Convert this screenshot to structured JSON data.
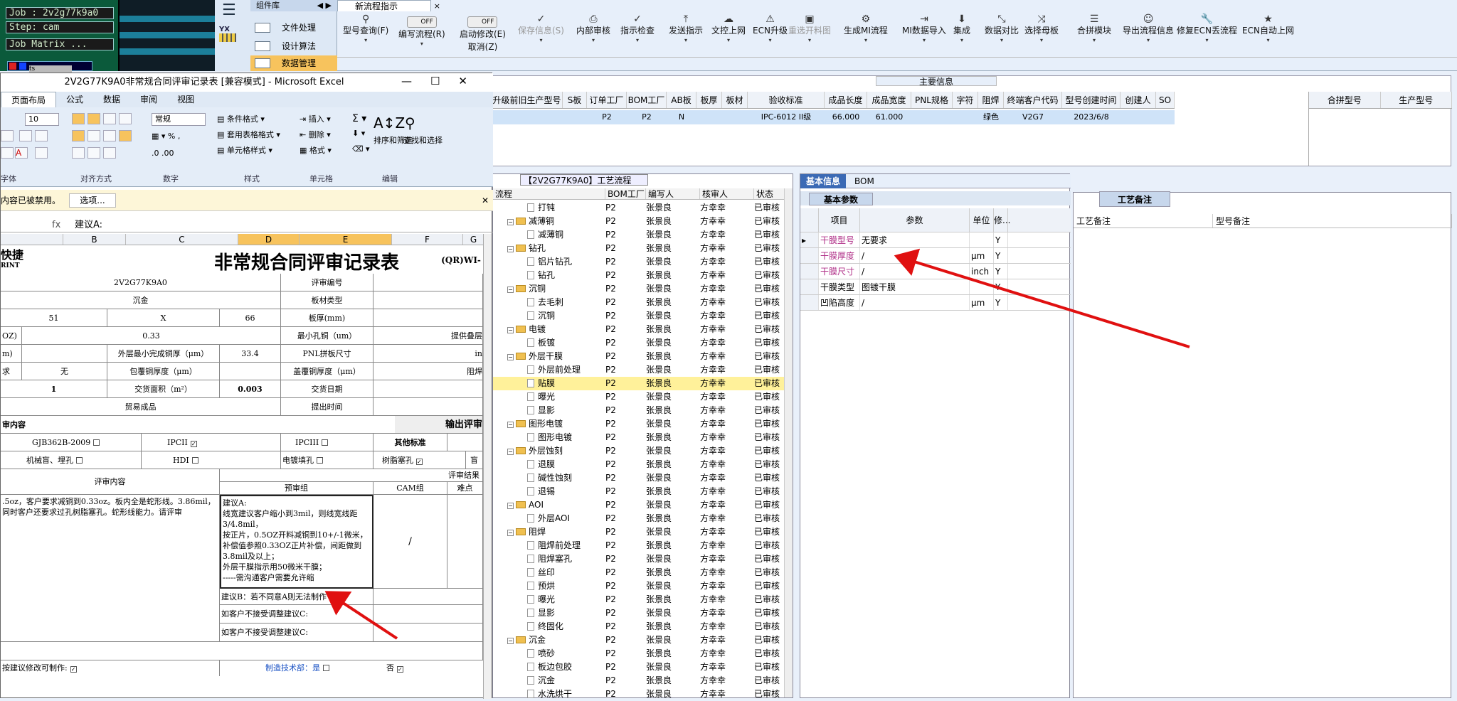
{
  "terminal": {
    "job": "Job : 2v2g77k9a0",
    "step": "Step: cam",
    "matrix": "Job Matrix ...",
    "ts": "ts"
  },
  "leftnav": {
    "logo": "YX",
    "header": "组件库",
    "items": [
      "文件处理",
      "设计算法",
      "数据管理"
    ]
  },
  "ribbon": {
    "tab": "新流程指示",
    "buttons": [
      {
        "icon": "search-icon",
        "label": "型号查询(F)"
      },
      {
        "icon": "toggle",
        "label": "编写流程(R)",
        "toggle": "OFF"
      },
      {
        "icon": "toggle",
        "label": "启动修改(E)",
        "toggle": "OFF",
        "sub": "取消(Z)"
      },
      {
        "icon": "check-icon",
        "label": "保存信息(S)",
        "disabled": true
      },
      {
        "icon": "print-icon",
        "label": "内部审核"
      },
      {
        "icon": "check-icon",
        "label": "指示检查"
      },
      {
        "icon": "upload-icon",
        "label": "发送指示"
      },
      {
        "icon": "cloud-upload-icon",
        "label": "文控上网"
      },
      {
        "icon": "ecn-icon",
        "label": "ECN升级"
      },
      {
        "icon": "image-icon",
        "label": "重选开料图",
        "disabled": true
      },
      {
        "icon": "flow-icon",
        "label": "生成MI流程"
      },
      {
        "icon": "import-icon",
        "label": "MI数据导入"
      },
      {
        "icon": "merge-icon",
        "label": "集成"
      },
      {
        "icon": "compare-icon",
        "label": "数据对比"
      },
      {
        "icon": "shuffle-icon",
        "label": "选择母板"
      },
      {
        "icon": "list-icon",
        "label": "合拼模块"
      },
      {
        "icon": "smile-icon",
        "label": "导出流程信息"
      },
      {
        "icon": "wrench-icon",
        "label": "修复ECN丢流程"
      },
      {
        "icon": "star-icon",
        "label": "ECN自动上网"
      }
    ]
  },
  "main_info": {
    "title": "主要信息",
    "columns": [
      "升级前旧生产型号",
      "S板",
      "订单工厂",
      "BOM工厂",
      "AB板",
      "板厚",
      "板材",
      "验收标准",
      "成品长度",
      "成品宽度",
      "PNL规格",
      "字符",
      "阻焊",
      "终端客户代码",
      "型号创建时间",
      "创建人",
      "SO"
    ],
    "row": [
      "",
      "",
      "P2",
      "P2",
      "N",
      "",
      "",
      "IPC-6012 II级",
      "66.000",
      "61.000",
      "",
      "",
      "绿色",
      "V2G7",
      "2023/6/8",
      "",
      ""
    ],
    "right_columns": [
      "合拼型号",
      "生产型号"
    ]
  },
  "process": {
    "title": "【2V2G77K9A0】工艺流程",
    "columns": [
      "流程",
      "BOM工厂",
      "编写人",
      "核审人",
      "状态"
    ],
    "rows": [
      {
        "name": "打钝",
        "type": "doc",
        "bom": "P2",
        "writer": "张景良",
        "reviewer": "方幸幸",
        "status": "已审核"
      },
      {
        "name": "减薄铜",
        "type": "folder",
        "bom": "P2",
        "writer": "张景良",
        "reviewer": "方幸幸",
        "status": "已审核"
      },
      {
        "name": "减薄铜",
        "type": "doc",
        "bom": "P2",
        "writer": "张景良",
        "reviewer": "方幸幸",
        "status": "已审核"
      },
      {
        "name": "钻孔",
        "type": "folder",
        "bom": "P2",
        "writer": "张景良",
        "reviewer": "方幸幸",
        "status": "已审核"
      },
      {
        "name": "铝片钻孔",
        "type": "doc",
        "bom": "P2",
        "writer": "张景良",
        "reviewer": "方幸幸",
        "status": "已审核"
      },
      {
        "name": "钻孔",
        "type": "doc",
        "bom": "P2",
        "writer": "张景良",
        "reviewer": "方幸幸",
        "status": "已审核"
      },
      {
        "name": "沉铜",
        "type": "folder",
        "bom": "P2",
        "writer": "张景良",
        "reviewer": "方幸幸",
        "status": "已审核"
      },
      {
        "name": "去毛刺",
        "type": "doc",
        "bom": "P2",
        "writer": "张景良",
        "reviewer": "方幸幸",
        "status": "已审核"
      },
      {
        "name": "沉铜",
        "type": "doc",
        "bom": "P2",
        "writer": "张景良",
        "reviewer": "方幸幸",
        "status": "已审核"
      },
      {
        "name": "电镀",
        "type": "folder",
        "bom": "P2",
        "writer": "张景良",
        "reviewer": "方幸幸",
        "status": "已审核"
      },
      {
        "name": "板镀",
        "type": "doc",
        "bom": "P2",
        "writer": "张景良",
        "reviewer": "方幸幸",
        "status": "已审核"
      },
      {
        "name": "外层干膜",
        "type": "folder",
        "bom": "P2",
        "writer": "张景良",
        "reviewer": "方幸幸",
        "status": "已审核"
      },
      {
        "name": "外层前处理",
        "type": "doc",
        "bom": "P2",
        "writer": "张景良",
        "reviewer": "方幸幸",
        "status": "已审核"
      },
      {
        "name": "贴膜",
        "type": "doc",
        "bom": "P2",
        "writer": "张景良",
        "reviewer": "方幸幸",
        "status": "已审核",
        "selected": true
      },
      {
        "name": "曝光",
        "type": "doc",
        "bom": "P2",
        "writer": "张景良",
        "reviewer": "方幸幸",
        "status": "已审核"
      },
      {
        "name": "显影",
        "type": "doc",
        "bom": "P2",
        "writer": "张景良",
        "reviewer": "方幸幸",
        "status": "已审核"
      },
      {
        "name": "图形电镀",
        "type": "folder",
        "bom": "P2",
        "writer": "张景良",
        "reviewer": "方幸幸",
        "status": "已审核"
      },
      {
        "name": "图形电镀",
        "type": "doc",
        "bom": "P2",
        "writer": "张景良",
        "reviewer": "方幸幸",
        "status": "已审核"
      },
      {
        "name": "外层蚀刻",
        "type": "folder",
        "bom": "P2",
        "writer": "张景良",
        "reviewer": "方幸幸",
        "status": "已审核"
      },
      {
        "name": "退膜",
        "type": "doc",
        "bom": "P2",
        "writer": "张景良",
        "reviewer": "方幸幸",
        "status": "已审核"
      },
      {
        "name": "碱性蚀刻",
        "type": "doc",
        "bom": "P2",
        "writer": "张景良",
        "reviewer": "方幸幸",
        "status": "已审核"
      },
      {
        "name": "退锡",
        "type": "doc",
        "bom": "P2",
        "writer": "张景良",
        "reviewer": "方幸幸",
        "status": "已审核"
      },
      {
        "name": "AOI",
        "type": "folder",
        "bom": "P2",
        "writer": "张景良",
        "reviewer": "方幸幸",
        "status": "已审核"
      },
      {
        "name": "外层AOI",
        "type": "doc",
        "bom": "P2",
        "writer": "张景良",
        "reviewer": "方幸幸",
        "status": "已审核"
      },
      {
        "name": "阻焊",
        "type": "folder",
        "bom": "P2",
        "writer": "张景良",
        "reviewer": "方幸幸",
        "status": "已审核"
      },
      {
        "name": "阻焊前处理",
        "type": "doc",
        "bom": "P2",
        "writer": "张景良",
        "reviewer": "方幸幸",
        "status": "已审核"
      },
      {
        "name": "阻焊塞孔",
        "type": "doc",
        "bom": "P2",
        "writer": "张景良",
        "reviewer": "方幸幸",
        "status": "已审核"
      },
      {
        "name": "丝印",
        "type": "doc",
        "bom": "P2",
        "writer": "张景良",
        "reviewer": "方幸幸",
        "status": "已审核"
      },
      {
        "name": "预烘",
        "type": "doc",
        "bom": "P2",
        "writer": "张景良",
        "reviewer": "方幸幸",
        "status": "已审核"
      },
      {
        "name": "曝光",
        "type": "doc",
        "bom": "P2",
        "writer": "张景良",
        "reviewer": "方幸幸",
        "status": "已审核"
      },
      {
        "name": "显影",
        "type": "doc",
        "bom": "P2",
        "writer": "张景良",
        "reviewer": "方幸幸",
        "status": "已审核"
      },
      {
        "name": "终固化",
        "type": "doc",
        "bom": "P2",
        "writer": "张景良",
        "reviewer": "方幸幸",
        "status": "已审核"
      },
      {
        "name": "沉金",
        "type": "folder",
        "bom": "P2",
        "writer": "张景良",
        "reviewer": "方幸幸",
        "status": "已审核"
      },
      {
        "name": "喷砂",
        "type": "doc",
        "bom": "P2",
        "writer": "张景良",
        "reviewer": "方幸幸",
        "status": "已审核"
      },
      {
        "name": "板边包胶",
        "type": "doc",
        "bom": "P2",
        "writer": "张景良",
        "reviewer": "方幸幸",
        "status": "已审核"
      },
      {
        "name": "沉金",
        "type": "doc",
        "bom": "P2",
        "writer": "张景良",
        "reviewer": "方幸幸",
        "status": "已审核"
      },
      {
        "name": "水洗烘干",
        "type": "doc",
        "bom": "P2",
        "writer": "张景良",
        "reviewer": "方幸幸",
        "status": "已审核"
      }
    ]
  },
  "basic_info": {
    "tabs": [
      "基本信息",
      "BOM"
    ],
    "subtab": "基本参数",
    "columns": [
      "项目",
      "参数",
      "单位",
      "修..."
    ],
    "rows": [
      {
        "item": "干膜型号",
        "param": "无要求",
        "unit": "",
        "mod": "Y",
        "pink": true
      },
      {
        "item": "干膜厚度",
        "param": "/",
        "unit": "μm",
        "mod": "Y",
        "pink": true
      },
      {
        "item": "干膜尺寸",
        "param": "/",
        "unit": "inch",
        "mod": "Y",
        "pink": true
      },
      {
        "item": "干膜类型",
        "param": "图镀干膜",
        "unit": "",
        "mod": "Y",
        "pink": false
      },
      {
        "item": "凹陷高度",
        "param": "/",
        "unit": "μm",
        "mod": "Y",
        "pink": false
      }
    ]
  },
  "notes": {
    "tab": "工艺备注",
    "columns": [
      "工艺备注",
      "型号备注"
    ]
  },
  "excel": {
    "title": "2V2G77K9A0非常规合同评审记录表 [兼容模式] - Microsoft Excel",
    "tabs": [
      "页面布局",
      "公式",
      "数据",
      "审阅",
      "视图"
    ],
    "font_size": "10",
    "number_format": "常规",
    "groups": [
      "字体",
      "对齐方式",
      "数字",
      "样式",
      "单元格",
      "编辑"
    ],
    "style_buttons": [
      "条件格式",
      "套用表格格式",
      "单元格样式"
    ],
    "cell_buttons": [
      "插入",
      "删除",
      "格式"
    ],
    "edit_buttons": [
      "排序和筛选",
      "查找和选择"
    ],
    "msg": "内容已被禁用。",
    "msg_button": "选项...",
    "formula": "建议A:",
    "fx": "fx",
    "col_headers": [
      "B",
      "C",
      "D",
      "E",
      "F",
      "G"
    ],
    "sheet": {
      "logo": "快捷",
      "logo_sub": "RINT",
      "title": "非常规合同评审记录表",
      "code": "(QR)WI-",
      "model": "2V2G77K9A0",
      "review_no": "评审编号",
      "surface": "沉金",
      "board_type": "板材类型",
      "dim_a": "51",
      "dim_x": "X",
      "dim_b": "66",
      "thickness": "板厚(mm)",
      "oz_label": "OZ)",
      "oz_val": "0.33",
      "min_hole": "最小孔铜（um）",
      "provide": "提供叠层",
      "um_label": "m)",
      "outer_cu": "外层最小完成铜厚（μm）",
      "outer_val": "33.4",
      "pnl": "PNL拼板尺寸",
      "pnl_val": "in",
      "req": "求",
      "none": "无",
      "wrap_cu": "包覆铜厚度（μm）",
      "cap_cu": "盖覆铜厚度（μm）",
      "solder_r": "阻焊",
      "qty": "1",
      "area": "交货面积（m²）",
      "area_val": "0.003",
      "date": "交货日期",
      "trade": "贸易成品",
      "submit": "提出时间",
      "review_content_hdr": "审内容",
      "output": "输出评审",
      "std1": "GJB362B-2009",
      "std2": "IPCII",
      "std3": "IPCIII",
      "std4": "其他标准",
      "mech": "机械盲、埋孔",
      "hdi": "HDI",
      "plate_fill": "电镀填孔",
      "resin": "树脂塞孔",
      "blind": "盲",
      "review_content": "评审内容",
      "review_result": "评审结果",
      "pre_review": "预审组",
      "cam": "CAM组",
      "diff": "难点",
      "content_text": ".5oz，客户要求减铜到0.33oz。板内全是蛇形线。3.86mil，同时客户还要求过孔树脂塞孔。蛇形线能力。请评审",
      "suggest_a": "建议A:\n线宽建议客户缩小到3mil，则线宽线距3/4.8mil，\n按正片，0.5OZ开料减铜到10+/-1微米，补偿值参照0.33OZ正片补偿，间距做到3.8mil及以上；\n外层干膜指示用50微米干膜；\n-----需沟通客户需要允许缩",
      "cam_val": "/",
      "suggest_b": "建议B：若不同意A则无法制作",
      "suggest_c1": "如客户不接受调整建议C:",
      "suggest_c2": "如客户不接受调整建议C:",
      "accept": "按建议修改可制作:",
      "tech": "制造技术部：是",
      "no": "否"
    }
  }
}
